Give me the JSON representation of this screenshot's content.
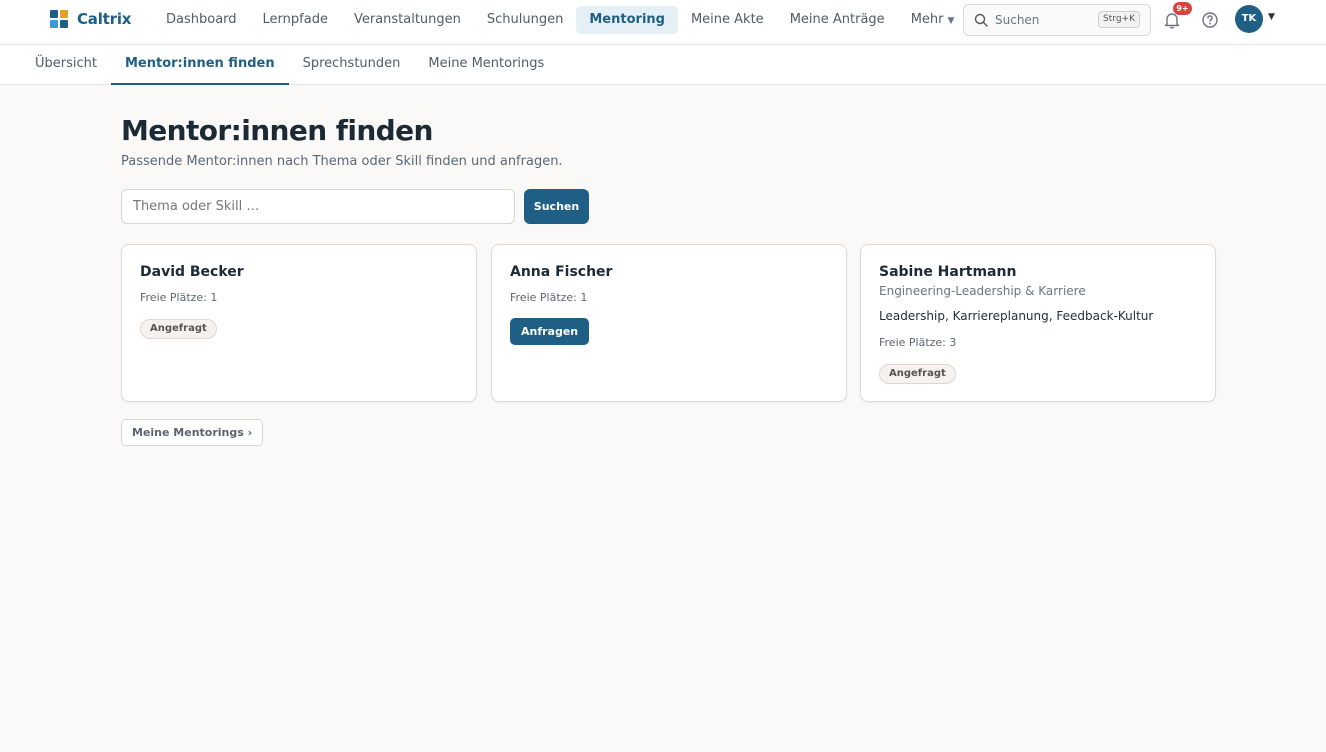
{
  "brand": {
    "name": "Caltrix",
    "logo_colors": [
      "#1f5f85",
      "#e0a323",
      "#3a9bd5",
      "#1f5f85"
    ]
  },
  "nav": {
    "items": [
      {
        "label": "Dashboard"
      },
      {
        "label": "Lernpfade"
      },
      {
        "label": "Veranstaltungen"
      },
      {
        "label": "Schulungen"
      },
      {
        "label": "Mentoring",
        "active": true
      },
      {
        "label": "Meine Akte"
      },
      {
        "label": "Meine Anträge"
      },
      {
        "label": "Mehr",
        "icon": "chevron-down-icon"
      }
    ]
  },
  "header": {
    "search_label": "Suchen",
    "search_shortcut": "Strg+K",
    "notification_badge": "9+",
    "avatar_initials": "TK"
  },
  "subnav": {
    "items": [
      {
        "label": "Übersicht"
      },
      {
        "label": "Mentor:innen finden",
        "active": true
      },
      {
        "label": "Sprechstunden"
      },
      {
        "label": "Meine Mentorings"
      }
    ]
  },
  "main": {
    "title": "Mentor:innen finden",
    "subtitle": "Passende Mentor:innen nach Thema oder Skill finden und anfragen.",
    "search_placeholder": "Thema oder Skill …",
    "search_button": "Suchen",
    "back_link": "Meine Mentorings ›"
  },
  "mentors": [
    {
      "name": "David Becker",
      "focus": "",
      "tags": "",
      "seats": "Freie Plätze: 1",
      "status": "Angefragt",
      "action": ""
    },
    {
      "name": "Anna Fischer",
      "focus": "",
      "tags": "",
      "seats": "Freie Plätze: 1",
      "status": "",
      "action": "Anfragen"
    },
    {
      "name": "Sabine Hartmann",
      "focus": "Engineering-Leadership & Karriere",
      "tags": "Leadership, Karriereplanung, Feedback-Kultur",
      "seats": "Freie Plätze: 3",
      "status": "Angefragt",
      "action": ""
    }
  ],
  "colors": {
    "primary": "#1f5f85",
    "badge": "#d7443e",
    "background": "#faf9f7"
  }
}
